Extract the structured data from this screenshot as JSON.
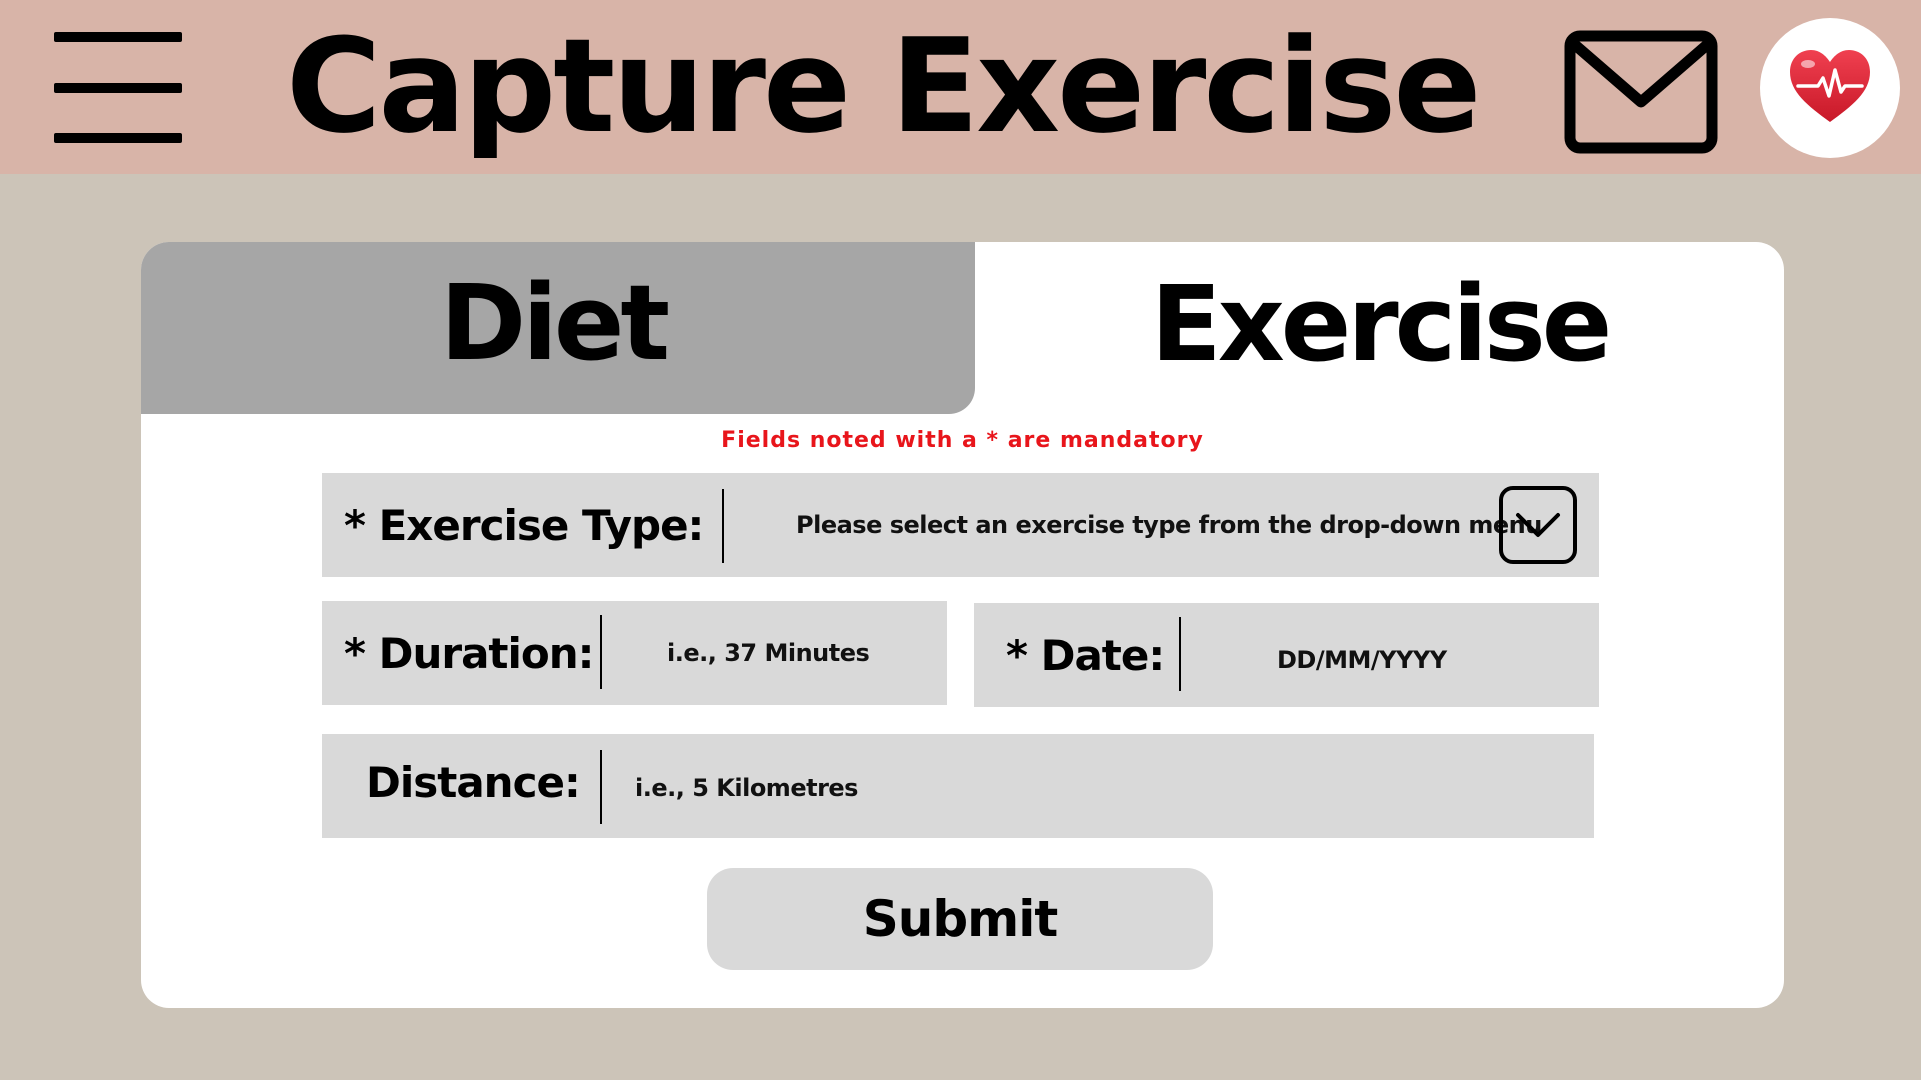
{
  "header": {
    "title": "Capture Exercise",
    "menu_icon": "hamburger-menu-icon",
    "mail_icon": "mail-icon",
    "profile_icon": "heart-pulse-icon",
    "background_color": "#d8b4a8"
  },
  "tabs": [
    {
      "label": "Diet",
      "active": false
    },
    {
      "label": "Exercise",
      "active": true
    }
  ],
  "form": {
    "mandatory_note": "Fields noted with a * are mandatory",
    "exercise_type": {
      "label": "* Exercise Type:",
      "placeholder": "Please select an exercise type from the drop-down menu",
      "dropdown_icon": "chevron-down-icon"
    },
    "duration": {
      "label": "* Duration:",
      "placeholder": "i.e., 37 Minutes"
    },
    "date": {
      "label": "* Date:",
      "placeholder": "DD/MM/YYYY"
    },
    "distance": {
      "label": "Distance:",
      "placeholder": "i.e., 5 Kilometres"
    },
    "submit_label": "Submit"
  },
  "colors": {
    "page_background": "#ccc4b8",
    "card_background": "#ffffff",
    "inactive_tab": "#a6a6a6",
    "field_background": "#d9d9d9",
    "mandatory_text": "#e8151b",
    "heart": "#e02030"
  }
}
